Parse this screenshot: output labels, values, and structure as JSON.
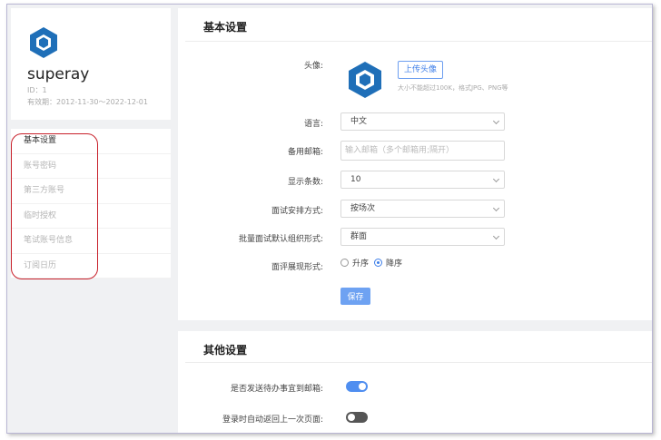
{
  "profile": {
    "username": "superay",
    "id_text": "ID：1",
    "validity_text": "有效期：2012-11-30～2022-12-01"
  },
  "menu": {
    "items": [
      {
        "label": "基本设置",
        "active": true
      },
      {
        "label": "账号密码",
        "active": false
      },
      {
        "label": "第三方账号",
        "active": false
      },
      {
        "label": "临时授权",
        "active": false
      },
      {
        "label": "笔试账号信息",
        "active": false
      },
      {
        "label": "订阅日历",
        "active": false
      }
    ]
  },
  "basic": {
    "title": "基本设置",
    "avatar_label": "头像:",
    "upload_label": "上传头像",
    "upload_hint": "大小不能超过100K，格式JPG、PNG等",
    "language_label": "语言:",
    "language_value": "中文",
    "backup_email_label": "备用邮箱:",
    "backup_email_placeholder": "输入邮箱（多个邮箱用;隔开）",
    "display_count_label": "显示条数:",
    "display_count_value": "10",
    "interview_arrange_label": "面试安排方式:",
    "interview_arrange_value": "按场次",
    "batch_org_label": "批量面试默认组织形式:",
    "batch_org_value": "群面",
    "review_display_label": "面评展现形式:",
    "review_asc_label": "升序",
    "review_desc_label": "降序",
    "review_selected": "desc",
    "save_label": "保存"
  },
  "other": {
    "title": "其他设置",
    "send_todo_label": "是否发送待办事宜到邮箱:",
    "send_todo_on": true,
    "auto_return_label": "登录时自动返回上一次页面:",
    "auto_return_on": false
  },
  "colors": {
    "accent": "#3d7ee8",
    "logo": "#1f6fb8",
    "highlight_outline": "#c8202a"
  }
}
